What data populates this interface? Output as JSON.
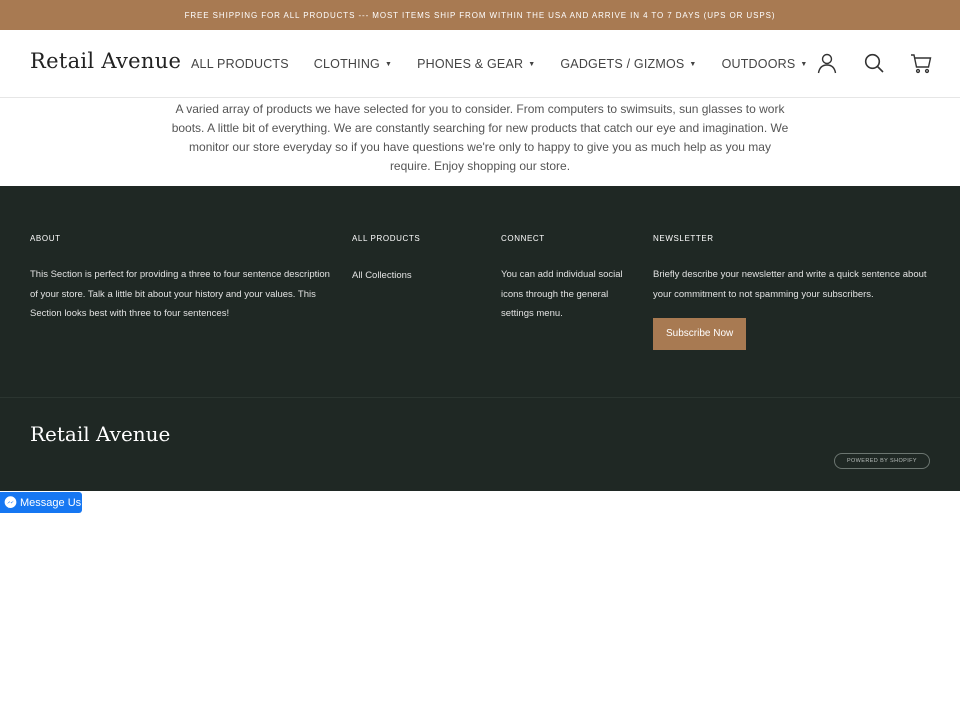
{
  "announcement": "FREE SHIPPING FOR ALL PRODUCTS --- MOST ITEMS SHIP FROM WITHIN THE USA AND ARRIVE IN 4 TO 7 DAYS (UPS OR USPS)",
  "header": {
    "logo": "Retail Avenue",
    "nav": [
      {
        "label": "ALL PRODUCTS",
        "dropdown": false
      },
      {
        "label": "CLOTHING",
        "dropdown": true
      },
      {
        "label": "PHONES & GEAR",
        "dropdown": true
      },
      {
        "label": "GADGETS / GIZMOS",
        "dropdown": true
      },
      {
        "label": "OUTDOORS",
        "dropdown": true
      }
    ],
    "icons": [
      "account-icon",
      "search-icon",
      "cart-icon"
    ]
  },
  "intro": "A varied array of products we have selected for you to consider. From computers to swimsuits, sun glasses to work boots. A little bit of everything. We are constantly searching for new products that catch our eye and imagination. We monitor our store everyday so if you have questions we're only to happy to give you as much help as you may require. Enjoy shopping our store.",
  "footer": {
    "about": {
      "heading": "ABOUT",
      "text": "This Section is perfect for providing a three to four sentence description of your store. Talk a little bit about your history and your values. This Section looks best with three to four sentences!"
    },
    "products": {
      "heading": "ALL PRODUCTS",
      "link": "All Collections"
    },
    "connect": {
      "heading": "CONNECT",
      "text": "You can add individual social icons through the general settings menu."
    },
    "newsletter": {
      "heading": "NEWSLETTER",
      "text": "Briefly describe your newsletter and write a quick sentence about your commitment to not spamming your subscribers.",
      "button": "Subscribe Now"
    },
    "logo": "Retail Avenue",
    "powered": "POWERED BY SHOPIFY"
  },
  "messenger": {
    "label": "Message Us"
  },
  "colors": {
    "accent": "#a87a52",
    "footer_bg": "#1f2824",
    "messenger": "#1677f2"
  }
}
